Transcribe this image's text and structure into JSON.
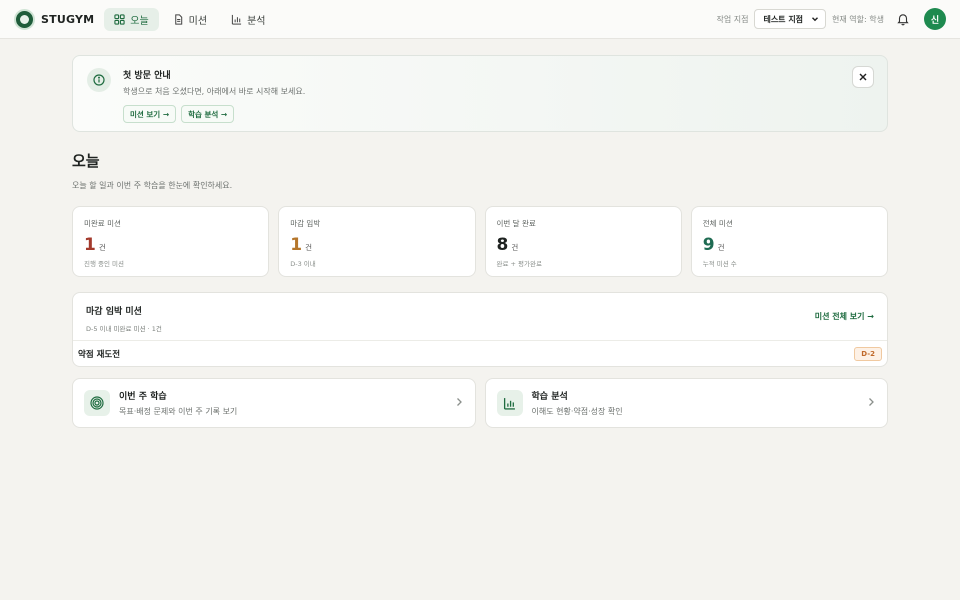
{
  "brand": {
    "name": "STUGYM"
  },
  "nav": {
    "tabs": [
      {
        "label": "오늘",
        "icon": "grid-icon",
        "active": true
      },
      {
        "label": "미션",
        "icon": "document-icon",
        "active": false
      },
      {
        "label": "분석",
        "icon": "bar-chart-icon",
        "active": false
      }
    ]
  },
  "header": {
    "branch_label": "작업 지점",
    "branch_value": "테스트 지점",
    "role_text": "현재 역할: 학생",
    "avatar_initial": "신"
  },
  "notice": {
    "title": "첫 방문 안내",
    "desc": "학생으로 처음 오셨다면, 아래에서 바로 시작해 보세요.",
    "btn_missions": "미션 보기 →",
    "btn_analysis": "학습 분석 →"
  },
  "page": {
    "title": "오늘",
    "subtitle": "오늘 할 일과 이번 주 학습을 한눈에 확인하세요."
  },
  "stats": [
    {
      "label": "미완료 미션",
      "value": "1",
      "unit": "건",
      "hint": "진행 중인 미션",
      "color": "#a33a2c"
    },
    {
      "label": "마감 임박",
      "value": "1",
      "unit": "건",
      "hint": "D-3 이내",
      "color": "#b5762b"
    },
    {
      "label": "이번 달 완료",
      "value": "8",
      "unit": "건",
      "hint": "완료 + 평가완료",
      "color": "#1f2321"
    },
    {
      "label": "전체 미션",
      "value": "9",
      "unit": "건",
      "hint": "누적 미션 수",
      "color": "#1e6b52"
    }
  ],
  "deadline": {
    "title": "마감 임박 미션",
    "subtitle": "D-5 이내 미완료 미션 · 1건",
    "link": "미션 전체 보기 →",
    "items": [
      {
        "title": "약점 재도전",
        "badge": "D-2"
      }
    ]
  },
  "cards": [
    {
      "title": "이번 주 학습",
      "desc": "목표·배정 문제와 이번 주 기록 보기",
      "icon": "target-icon"
    },
    {
      "title": "학습 분석",
      "desc": "이해도 현황·약점·성장 확인",
      "icon": "bar-chart-icon"
    }
  ],
  "colors": {
    "accent": "#1e6b3f",
    "avatar": "#1e8a4f",
    "background": "#f4f3ef"
  }
}
